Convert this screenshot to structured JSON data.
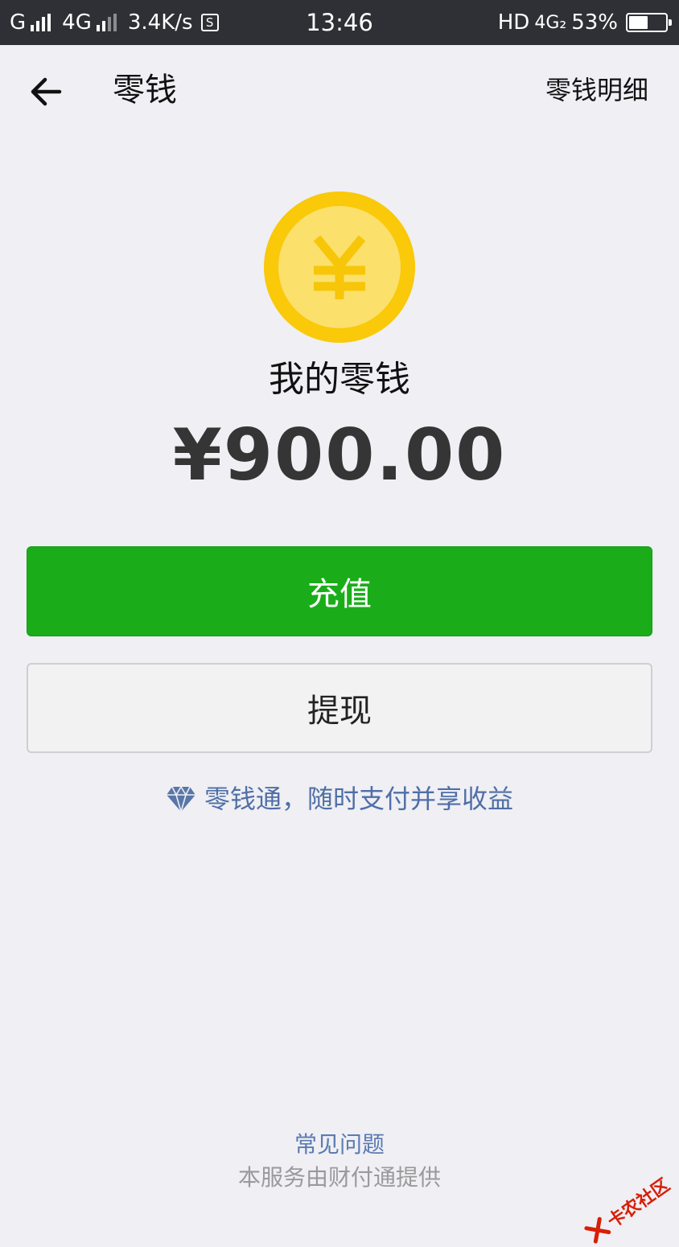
{
  "status_bar": {
    "carrier1": "G",
    "carrier2": "4G",
    "speed": "3.4K/s",
    "s_badge": "S",
    "time": "13:46",
    "hd": "HD",
    "net": "4G₂",
    "battery": "53%",
    "battery_level": 0.53
  },
  "nav": {
    "back_icon": "arrow-left-icon",
    "title": "零钱",
    "right_label": "零钱明细"
  },
  "wallet": {
    "coin_icon": "yuan-coin-icon",
    "coin_symbol": "¥",
    "label": "我的零钱",
    "balance": "¥900.00"
  },
  "actions": {
    "recharge": "充值",
    "withdraw": "提现"
  },
  "promo": {
    "icon": "diamond-icon",
    "text": "零钱通，随时支付并享收益"
  },
  "footer": {
    "faq": "常见问题",
    "provider": "本服务由财付通提供"
  },
  "watermark": {
    "text": "卡农社区"
  },
  "colors": {
    "accent_green": "#1aad19",
    "link_blue": "#5b7bb0",
    "coin_yellow": "#f9c90a",
    "background": "#efeff4"
  }
}
